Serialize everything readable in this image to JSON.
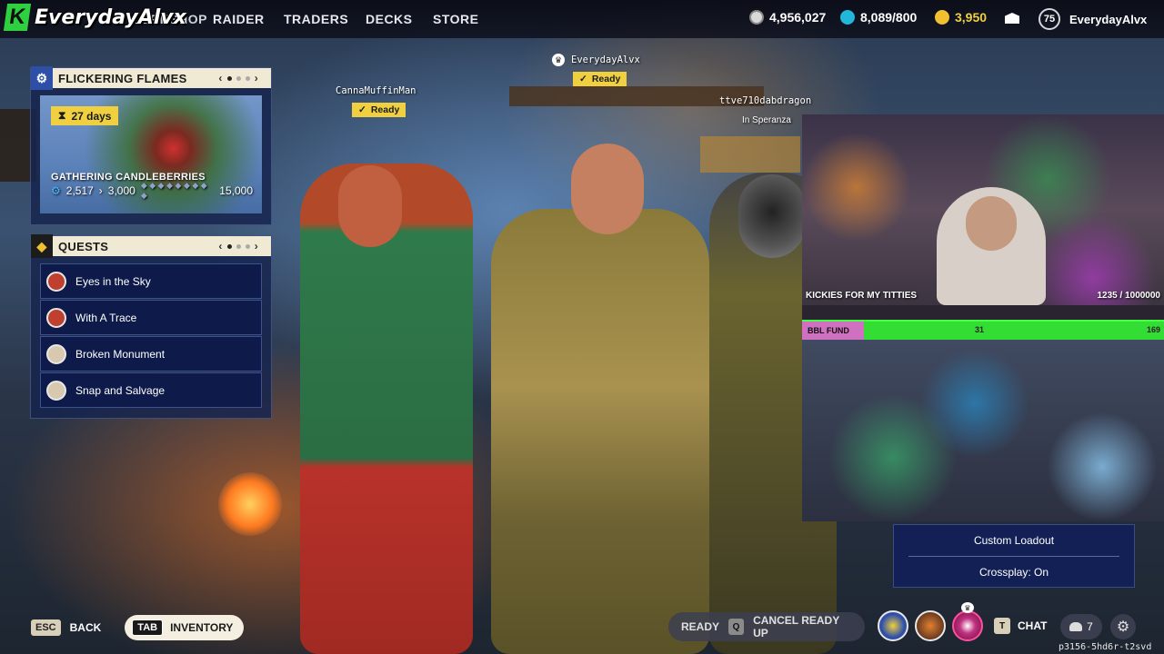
{
  "watermark": {
    "k_letter": "K",
    "streamer": "EverydayAlvx"
  },
  "nav": {
    "hidden_item": "WORKSHOP",
    "items": [
      "RAIDER",
      "TRADERS",
      "DECKS",
      "STORE"
    ]
  },
  "currencies": {
    "coins": "4,956,027",
    "tokens": "8,089/800",
    "gold": "3,950"
  },
  "profile": {
    "level": "75",
    "username": "EverydayAlvx"
  },
  "event_panel": {
    "title": "FLICKERING FLAMES",
    "days_left": "27 days",
    "event_name": "GATHERING CANDLEBERRIES",
    "progress_current": "2,517",
    "progress_next": "3,000",
    "progress_max": "15,000",
    "progress_dots": "◆ ◆ ◆ ◆ ◆ ◆ ◆ ◆ ◆"
  },
  "quests_panel": {
    "title": "QUESTS",
    "items": [
      {
        "label": "Eyes in the Sky"
      },
      {
        "label": "With A Trace"
      },
      {
        "label": "Broken Monument"
      },
      {
        "label": "Snap and Salvage"
      }
    ]
  },
  "players": {
    "leader": {
      "name": "EverydayAlvx",
      "status": "Ready"
    },
    "left": {
      "name": "CannaMuffinMan",
      "status": "Ready"
    },
    "right": {
      "name": "ttve710dabdragon",
      "location": "In Speranza"
    }
  },
  "stream_overlay": {
    "goal_text": "KICKIES FOR MY TITTIES",
    "goal_progress": "1235 / 1000000",
    "fund_label": "BBL FUND",
    "fund_current": "31",
    "fund_max": "169",
    "fund_fraction": 0.18
  },
  "loadout": {
    "custom_loadout": "Custom Loadout",
    "crossplay": "Crossplay: On"
  },
  "bottom": {
    "esc_key": "ESC",
    "back_label": "BACK",
    "tab_key": "TAB",
    "inventory_label": "INVENTORY",
    "ready_label": "READY",
    "q_key": "Q",
    "cancel_label": "CANCEL READY UP",
    "t_key": "T",
    "chat_label": "CHAT",
    "friends_count": "7",
    "session_id": "p3156-5hd6r-t2svd"
  }
}
